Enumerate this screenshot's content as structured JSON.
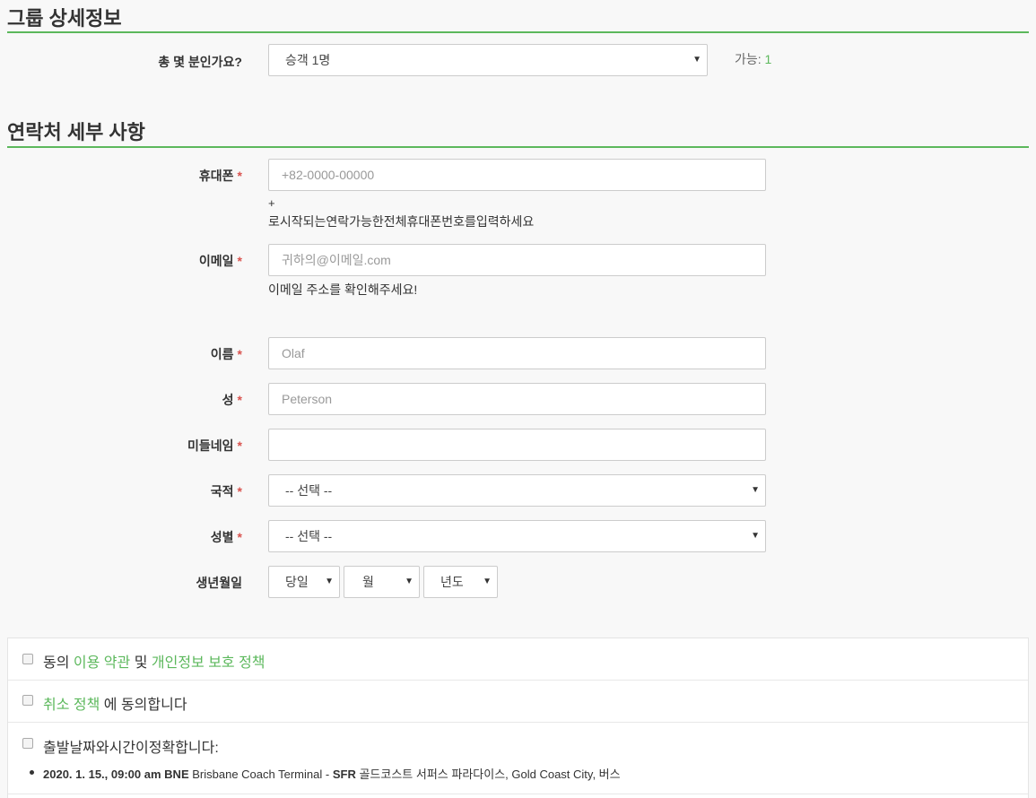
{
  "group": {
    "title": "그룹 상세정보",
    "count_label": "총 몇 분인가요?",
    "count_value": "승객 1명",
    "available_label": "가능:",
    "available_value": "1"
  },
  "contact": {
    "title": "연락처 세부 사항",
    "required_mark": "*",
    "phone": {
      "label": "휴대폰",
      "placeholder": "+82-0000-00000",
      "help_plus": "+",
      "help": "로시작되는연락가능한전체휴대폰번호를입력하세요"
    },
    "email": {
      "label": "이메일",
      "placeholder": "귀하의@이메일.com",
      "help": "이메일 주소를 확인해주세요!"
    },
    "first_name": {
      "label": "이름",
      "placeholder": "Olaf"
    },
    "last_name": {
      "label": "성",
      "placeholder": "Peterson"
    },
    "middle_name": {
      "label": "미들네임",
      "placeholder": ""
    },
    "nationality": {
      "label": "국적",
      "value": "-- 선택 --"
    },
    "gender": {
      "label": "성별",
      "value": "-- 선택 --"
    },
    "birthdate": {
      "label": "생년월일",
      "day": "당일",
      "month": "월",
      "year": "년도"
    }
  },
  "agreements": {
    "terms_prefix": "동의",
    "terms_link": "이용 약관",
    "terms_and": "및",
    "privacy_link": "개인정보 보호 정책",
    "cancel_link": "취소 정책",
    "cancel_suffix": "에 동의합니다",
    "datetime_confirm": "출발날짜와시간이정확합니다:",
    "trip": {
      "datetime": "2020. 1. 15., 09:00 am",
      "from_code": "BNE",
      "from_name": "Brisbane Coach Terminal -",
      "to_code": "SFR",
      "to_name": "골드코스트 서퍼스 파라다이스, Gold Coast City, 버스"
    }
  },
  "colors": {
    "accent": "#5cb85c",
    "required": "#d9534f"
  }
}
